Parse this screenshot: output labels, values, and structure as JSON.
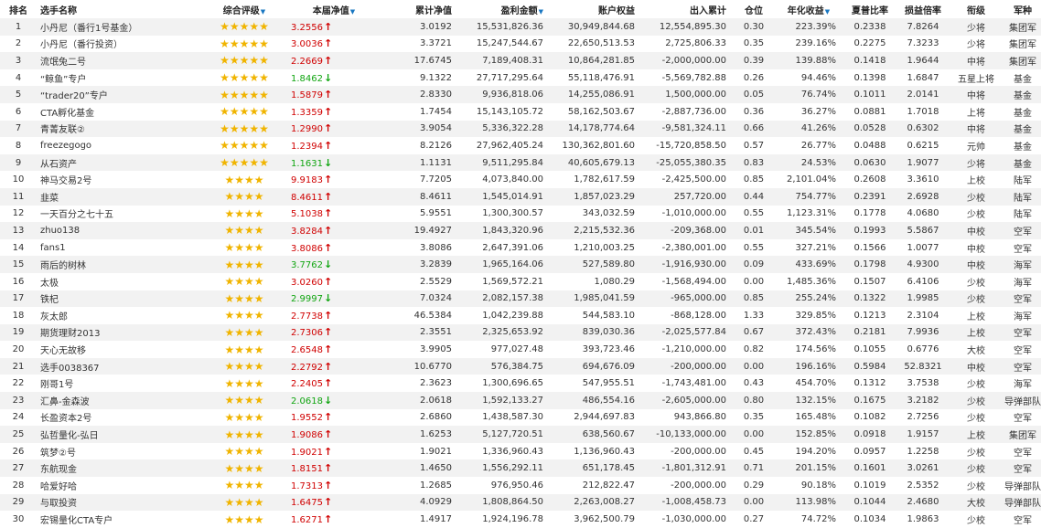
{
  "headers": {
    "rank": "排名",
    "name": "选手名称",
    "rating": "综合评级",
    "nav": "本届净值",
    "cum_nav": "累计净值",
    "profit": "盈利金额",
    "equity": "账户权益",
    "inout": "出入累计",
    "position": "仓位",
    "annual": "年化收益",
    "sharpe": "夏普比率",
    "pl_ratio": "损益倍率",
    "title": "衔级",
    "army": "军种"
  },
  "rows": [
    {
      "rank": "1",
      "name": "小丹尼（番行1号基金）",
      "stars": "★★★★★",
      "nav": "3.2556",
      "dir": "up",
      "cum": "3.0192",
      "profit": "15,531,826.36",
      "equity": "30,949,844.68",
      "inout": "12,554,895.30",
      "pos": "0.30",
      "annual": "223.39%",
      "sharpe": "0.2338",
      "pl": "7.8264",
      "title": "少将",
      "army": "集团军"
    },
    {
      "rank": "2",
      "name": "小丹尼（番行投资）",
      "stars": "★★★★★",
      "nav": "3.0036",
      "dir": "up",
      "cum": "3.3721",
      "profit": "15,247,544.67",
      "equity": "22,650,513.53",
      "inout": "2,725,806.33",
      "pos": "0.35",
      "annual": "239.16%",
      "sharpe": "0.2275",
      "pl": "7.3233",
      "title": "少将",
      "army": "集团军"
    },
    {
      "rank": "3",
      "name": "流氓兔二号",
      "stars": "★★★★★",
      "nav": "2.2669",
      "dir": "up",
      "cum": "17.6745",
      "profit": "7,189,408.31",
      "equity": "10,864,281.85",
      "inout": "-2,000,000.00",
      "pos": "0.39",
      "annual": "139.88%",
      "sharpe": "0.1418",
      "pl": "1.9644",
      "title": "中将",
      "army": "集团军"
    },
    {
      "rank": "4",
      "name": "“鲸鱼”专户",
      "stars": "★★★★★",
      "nav": "1.8462",
      "dir": "down",
      "cum": "9.1322",
      "profit": "27,717,295.64",
      "equity": "55,118,476.91",
      "inout": "-5,569,782.88",
      "pos": "0.26",
      "annual": "94.46%",
      "sharpe": "0.1398",
      "pl": "1.6847",
      "title": "五星上将",
      "army": "基金"
    },
    {
      "rank": "5",
      "name": "“trader20”专户",
      "stars": "★★★★★",
      "nav": "1.5879",
      "dir": "up",
      "cum": "2.8330",
      "profit": "9,936,818.06",
      "equity": "14,255,086.91",
      "inout": "1,500,000.00",
      "pos": "0.05",
      "annual": "76.74%",
      "sharpe": "0.1011",
      "pl": "2.0141",
      "title": "中将",
      "army": "基金"
    },
    {
      "rank": "6",
      "name": "CTA孵化基金",
      "stars": "★★★★★",
      "nav": "1.3359",
      "dir": "up",
      "cum": "1.7454",
      "profit": "15,143,105.72",
      "equity": "58,162,503.67",
      "inout": "-2,887,736.00",
      "pos": "0.36",
      "annual": "36.27%",
      "sharpe": "0.0881",
      "pl": "1.7018",
      "title": "上将",
      "army": "基金"
    },
    {
      "rank": "7",
      "name": "青菁友联②",
      "stars": "★★★★★",
      "nav": "1.2990",
      "dir": "up",
      "cum": "3.9054",
      "profit": "5,336,322.28",
      "equity": "14,178,774.64",
      "inout": "-9,581,324.11",
      "pos": "0.66",
      "annual": "41.26%",
      "sharpe": "0.0528",
      "pl": "0.6302",
      "title": "中将",
      "army": "基金"
    },
    {
      "rank": "8",
      "name": "freezegogo",
      "stars": "★★★★★",
      "nav": "1.2394",
      "dir": "up",
      "cum": "8.2126",
      "profit": "27,962,405.24",
      "equity": "130,362,801.60",
      "inout": "-15,720,858.50",
      "pos": "0.57",
      "annual": "26.77%",
      "sharpe": "0.0488",
      "pl": "0.6215",
      "title": "元帅",
      "army": "基金"
    },
    {
      "rank": "9",
      "name": "从石资产",
      "stars": "★★★★★",
      "nav": "1.1631",
      "dir": "down",
      "cum": "1.1131",
      "profit": "9,511,295.84",
      "equity": "40,605,679.13",
      "inout": "-25,055,380.35",
      "pos": "0.83",
      "annual": "24.53%",
      "sharpe": "0.0630",
      "pl": "1.9077",
      "title": "少将",
      "army": "基金"
    },
    {
      "rank": "10",
      "name": "神马交易2号",
      "stars": "★★★★",
      "nav": "9.9183",
      "dir": "up",
      "cum": "7.7205",
      "profit": "4,073,840.00",
      "equity": "1,782,617.59",
      "inout": "-2,425,500.00",
      "pos": "0.85",
      "annual": "2,101.04%",
      "sharpe": "0.2608",
      "pl": "3.3610",
      "title": "上校",
      "army": "陆军"
    },
    {
      "rank": "11",
      "name": "韭菜",
      "stars": "★★★★",
      "nav": "8.4611",
      "dir": "up",
      "cum": "8.4611",
      "profit": "1,545,014.91",
      "equity": "1,857,023.29",
      "inout": "257,720.00",
      "pos": "0.44",
      "annual": "754.77%",
      "sharpe": "0.2391",
      "pl": "2.6928",
      "title": "少校",
      "army": "陆军"
    },
    {
      "rank": "12",
      "name": "一天百分之七十五",
      "stars": "★★★★",
      "nav": "5.1038",
      "dir": "up",
      "cum": "5.9551",
      "profit": "1,300,300.57",
      "equity": "343,032.59",
      "inout": "-1,010,000.00",
      "pos": "0.55",
      "annual": "1,123.31%",
      "sharpe": "0.1778",
      "pl": "4.0680",
      "title": "少校",
      "army": "陆军"
    },
    {
      "rank": "13",
      "name": "zhuo138",
      "stars": "★★★★",
      "nav": "3.8284",
      "dir": "up",
      "cum": "19.4927",
      "profit": "1,843,320.96",
      "equity": "2,215,532.36",
      "inout": "-209,368.00",
      "pos": "0.01",
      "annual": "345.54%",
      "sharpe": "0.1993",
      "pl": "5.5867",
      "title": "中校",
      "army": "空军"
    },
    {
      "rank": "14",
      "name": "fans1",
      "stars": "★★★★",
      "nav": "3.8086",
      "dir": "up",
      "cum": "3.8086",
      "profit": "2,647,391.06",
      "equity": "1,210,003.25",
      "inout": "-2,380,001.00",
      "pos": "0.55",
      "annual": "327.21%",
      "sharpe": "0.1566",
      "pl": "1.0077",
      "title": "中校",
      "army": "空军"
    },
    {
      "rank": "15",
      "name": "雨后的树林",
      "stars": "★★★★",
      "nav": "3.7762",
      "dir": "down",
      "cum": "3.2839",
      "profit": "1,965,164.06",
      "equity": "527,589.80",
      "inout": "-1,916,930.00",
      "pos": "0.09",
      "annual": "433.69%",
      "sharpe": "0.1798",
      "pl": "4.9300",
      "title": "中校",
      "army": "海军"
    },
    {
      "rank": "16",
      "name": "太极",
      "stars": "★★★★",
      "nav": "3.0260",
      "dir": "up",
      "cum": "2.5529",
      "profit": "1,569,572.21",
      "equity": "1,080.29",
      "inout": "-1,568,494.00",
      "pos": "0.00",
      "annual": "1,485.36%",
      "sharpe": "0.1507",
      "pl": "6.4106",
      "title": "少校",
      "army": "海军"
    },
    {
      "rank": "17",
      "name": "铁杞",
      "stars": "★★★★",
      "nav": "2.9997",
      "dir": "down",
      "cum": "7.0324",
      "profit": "2,082,157.38",
      "equity": "1,985,041.59",
      "inout": "-965,000.00",
      "pos": "0.85",
      "annual": "255.24%",
      "sharpe": "0.1322",
      "pl": "1.9985",
      "title": "少校",
      "army": "空军"
    },
    {
      "rank": "18",
      "name": "灰太郎",
      "stars": "★★★★",
      "nav": "2.7738",
      "dir": "up",
      "cum": "46.5384",
      "profit": "1,042,239.88",
      "equity": "544,583.10",
      "inout": "-868,128.00",
      "pos": "1.33",
      "annual": "329.85%",
      "sharpe": "0.1213",
      "pl": "2.3104",
      "title": "上校",
      "army": "海军"
    },
    {
      "rank": "19",
      "name": "期货理财2013",
      "stars": "★★★★",
      "nav": "2.7306",
      "dir": "up",
      "cum": "2.3551",
      "profit": "2,325,653.92",
      "equity": "839,030.36",
      "inout": "-2,025,577.84",
      "pos": "0.67",
      "annual": "372.43%",
      "sharpe": "0.2181",
      "pl": "7.9936",
      "title": "上校",
      "army": "空军"
    },
    {
      "rank": "20",
      "name": "天心无故移",
      "stars": "★★★★",
      "nav": "2.6548",
      "dir": "up",
      "cum": "3.9905",
      "profit": "977,027.48",
      "equity": "393,723.46",
      "inout": "-1,210,000.00",
      "pos": "0.82",
      "annual": "174.56%",
      "sharpe": "0.1055",
      "pl": "0.6776",
      "title": "大校",
      "army": "空军"
    },
    {
      "rank": "21",
      "name": "选手0038367",
      "stars": "★★★★",
      "nav": "2.2792",
      "dir": "up",
      "cum": "10.6770",
      "profit": "576,384.75",
      "equity": "694,676.09",
      "inout": "-200,000.00",
      "pos": "0.00",
      "annual": "196.16%",
      "sharpe": "0.5984",
      "pl": "52.8321",
      "title": "中校",
      "army": "空军"
    },
    {
      "rank": "22",
      "name": "刚哥1号",
      "stars": "★★★★",
      "nav": "2.2405",
      "dir": "up",
      "cum": "2.3623",
      "profit": "1,300,696.65",
      "equity": "547,955.51",
      "inout": "-1,743,481.00",
      "pos": "0.43",
      "annual": "454.70%",
      "sharpe": "0.1312",
      "pl": "3.7538",
      "title": "少校",
      "army": "海军"
    },
    {
      "rank": "23",
      "name": "汇鼻-金森波",
      "stars": "★★★★",
      "nav": "2.0618",
      "dir": "down",
      "cum": "2.0618",
      "profit": "1,592,133.27",
      "equity": "486,554.16",
      "inout": "-2,605,000.00",
      "pos": "0.80",
      "annual": "132.15%",
      "sharpe": "0.1675",
      "pl": "3.2182",
      "title": "少校",
      "army": "导弹部队"
    },
    {
      "rank": "24",
      "name": "长盈资本2号",
      "stars": "★★★★",
      "nav": "1.9552",
      "dir": "up",
      "cum": "2.6860",
      "profit": "1,438,587.30",
      "equity": "2,944,697.83",
      "inout": "943,866.80",
      "pos": "0.35",
      "annual": "165.48%",
      "sharpe": "0.1082",
      "pl": "2.7256",
      "title": "少校",
      "army": "空军"
    },
    {
      "rank": "25",
      "name": "弘哲量化-弘日",
      "stars": "★★★★",
      "nav": "1.9086",
      "dir": "up",
      "cum": "1.6253",
      "profit": "5,127,720.51",
      "equity": "638,560.67",
      "inout": "-10,133,000.00",
      "pos": "0.00",
      "annual": "152.85%",
      "sharpe": "0.0918",
      "pl": "1.9157",
      "title": "上校",
      "army": "集团军"
    },
    {
      "rank": "26",
      "name": "筑梦②号",
      "stars": "★★★★",
      "nav": "1.9021",
      "dir": "up",
      "cum": "1.9021",
      "profit": "1,336,960.43",
      "equity": "1,136,960.43",
      "inout": "-200,000.00",
      "pos": "0.45",
      "annual": "194.20%",
      "sharpe": "0.0957",
      "pl": "1.2258",
      "title": "少校",
      "army": "空军"
    },
    {
      "rank": "27",
      "name": "东航现金",
      "stars": "★★★★",
      "nav": "1.8151",
      "dir": "up",
      "cum": "1.4650",
      "profit": "1,556,292.11",
      "equity": "651,178.45",
      "inout": "-1,801,312.91",
      "pos": "0.71",
      "annual": "201.15%",
      "sharpe": "0.1601",
      "pl": "3.0261",
      "title": "少校",
      "army": "空军"
    },
    {
      "rank": "28",
      "name": "哈爱好哈",
      "stars": "★★★★",
      "nav": "1.7313",
      "dir": "up",
      "cum": "1.2685",
      "profit": "976,950.46",
      "equity": "212,822.47",
      "inout": "-200,000.00",
      "pos": "0.29",
      "annual": "90.18%",
      "sharpe": "0.1019",
      "pl": "2.5352",
      "title": "少校",
      "army": "导弹部队"
    },
    {
      "rank": "29",
      "name": "与取投资",
      "stars": "★★★★",
      "nav": "1.6475",
      "dir": "up",
      "cum": "4.0929",
      "profit": "1,808,864.50",
      "equity": "2,263,008.27",
      "inout": "-1,008,458.73",
      "pos": "0.00",
      "annual": "113.98%",
      "sharpe": "0.1044",
      "pl": "2.4680",
      "title": "大校",
      "army": "导弹部队"
    },
    {
      "rank": "30",
      "name": "宏锡量化CTA专户",
      "stars": "★★★★",
      "nav": "1.6271",
      "dir": "up",
      "cum": "1.4917",
      "profit": "1,924,196.78",
      "equity": "3,962,500.79",
      "inout": "-1,030,000.00",
      "pos": "0.27",
      "annual": "74.72%",
      "sharpe": "0.1034",
      "pl": "1.9863",
      "title": "少校",
      "army": "空军"
    }
  ],
  "colors": {
    "up": "#d00000",
    "down": "#11a511",
    "star": "#f0b400",
    "sort": "#1a78c2"
  },
  "icons": {
    "up": "arrow-up-icon",
    "down": "arrow-down-icon",
    "sort": "sort-desc-icon",
    "star": "star-icon"
  }
}
